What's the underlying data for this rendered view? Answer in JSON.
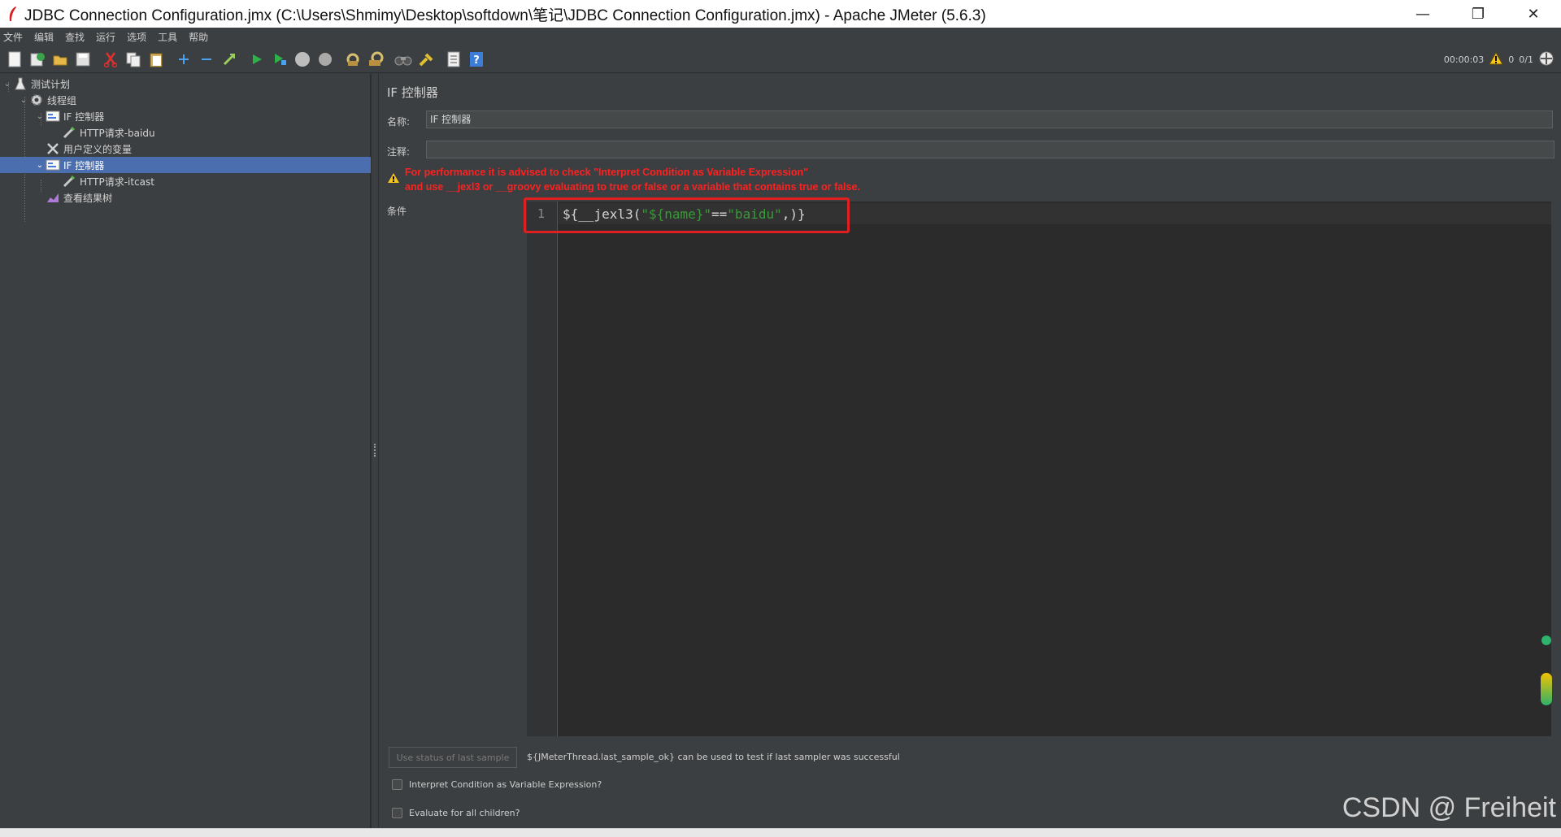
{
  "window": {
    "title": "JDBC Connection Configuration.jmx (C:\\Users\\Shmimy\\Desktop\\softdown\\笔记\\JDBC Connection Configuration.jmx) - Apache JMeter (5.6.3)",
    "minimize": "—",
    "restore": "❐",
    "close": "✕"
  },
  "menu": [
    "文件",
    "编辑",
    "查找",
    "运行",
    "选项",
    "工具",
    "帮助"
  ],
  "toolbar": {
    "buttons": [
      "new-icon",
      "templates-icon",
      "open-icon",
      "save-icon",
      "cut-icon",
      "copy-icon",
      "paste-icon",
      "expand-icon",
      "collapse-icon",
      "toggle-icon",
      "start-icon",
      "start-no-pause-icon",
      "stop-icon",
      "shutdown-icon",
      "clear-icon",
      "clear-all-icon",
      "search-icon",
      "reset-search-icon",
      "function-helper-icon",
      "help-icon"
    ],
    "timer": "00:00:03",
    "warnings": "0",
    "threads": "0/1"
  },
  "tree": {
    "items": [
      {
        "label": "测试计划",
        "depth": 0,
        "expanded": true,
        "icon": "test-plan-icon"
      },
      {
        "label": "线程组",
        "depth": 1,
        "expanded": true,
        "icon": "gear-icon"
      },
      {
        "label": "IF 控制器",
        "depth": 2,
        "expanded": true,
        "icon": "controller-icon"
      },
      {
        "label": "HTTP请求-baidu",
        "depth": 3,
        "expanded": false,
        "icon": "pipette-icon"
      },
      {
        "label": "用户定义的变量",
        "depth": 2,
        "expanded": false,
        "icon": "wrench-icon"
      },
      {
        "label": "IF 控制器",
        "depth": 2,
        "expanded": true,
        "icon": "controller-icon",
        "selected": true
      },
      {
        "label": "HTTP请求-itcast",
        "depth": 3,
        "expanded": false,
        "icon": "pipette-icon"
      },
      {
        "label": "查看结果树",
        "depth": 2,
        "expanded": false,
        "icon": "chart-icon"
      }
    ]
  },
  "panel": {
    "title": "IF 控制器",
    "name_label": "名称:",
    "name_value": "IF 控制器",
    "comment_label": "注释:",
    "comment_value": "",
    "warning_line1": "For performance it is advised to check \"Interpret Condition as Variable Expression\"",
    "warning_line2": "and use __jexl3 or __groovy evaluating to true or false or a variable that contains true or false.",
    "condition_label": "条件",
    "editor": {
      "line_number": "1",
      "code_part1": "${__jexl3(",
      "code_str1": "\"${name}\"",
      "code_part2": "==",
      "code_str2": "\"baidu\"",
      "code_part3": ",)}"
    },
    "use_status_button": "Use status of last sample",
    "hint": "${JMeterThread.last_sample_ok} can be used to test if last sampler was successful",
    "interpret_checkbox": "Interpret Condition as Variable Expression?",
    "evaluate_checkbox": "Evaluate for all children?"
  },
  "watermark": "CSDN @ Freiheit",
  "colors": {
    "warning": "#ff2020",
    "selection": "#4b6eaf",
    "highlight_box": "#e02020",
    "string": "#3a9a3a"
  }
}
